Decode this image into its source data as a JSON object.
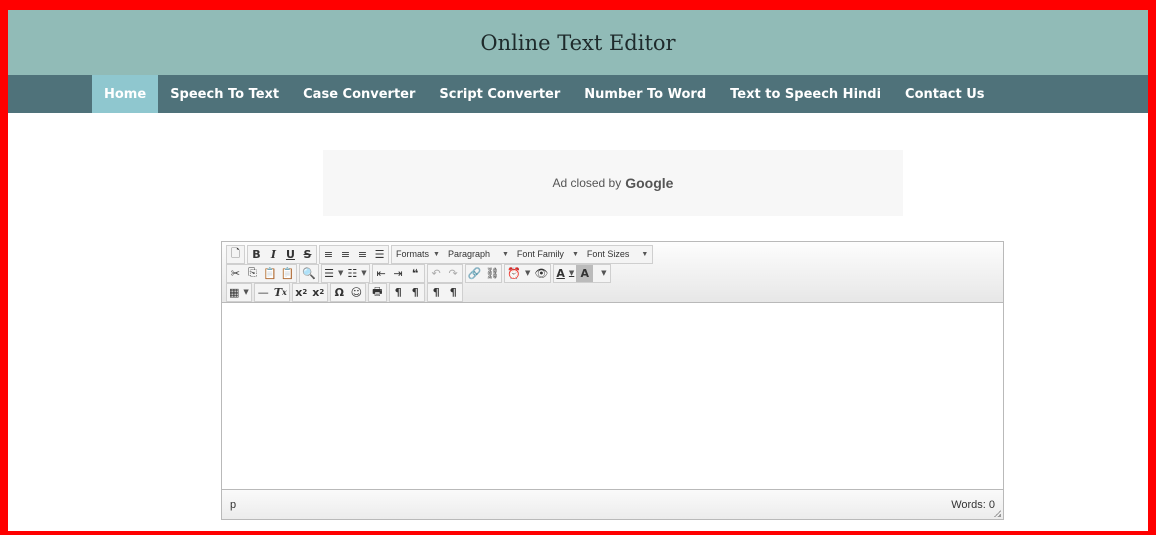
{
  "header": {
    "title": "Online Text Editor"
  },
  "nav": {
    "items": [
      {
        "label": "Home",
        "active": true
      },
      {
        "label": "Speech To Text"
      },
      {
        "label": "Case Converter"
      },
      {
        "label": "Script Converter"
      },
      {
        "label": "Number To Word"
      },
      {
        "label": "Text to Speech Hindi"
      },
      {
        "label": "Contact Us"
      }
    ]
  },
  "ad": {
    "text": "Ad closed by",
    "brand": "Google"
  },
  "editor": {
    "toolbar": {
      "formats": "Formats",
      "block": "Paragraph",
      "font_family": "Font Family",
      "font_sizes": "Font Sizes"
    },
    "status": {
      "path": "p",
      "word_count": "Words: 0"
    }
  },
  "colors": {
    "frame": "#ff0000",
    "header_bg": "#91bbb7",
    "nav_bg": "#4f727a",
    "nav_active": "#8fc7cf"
  }
}
